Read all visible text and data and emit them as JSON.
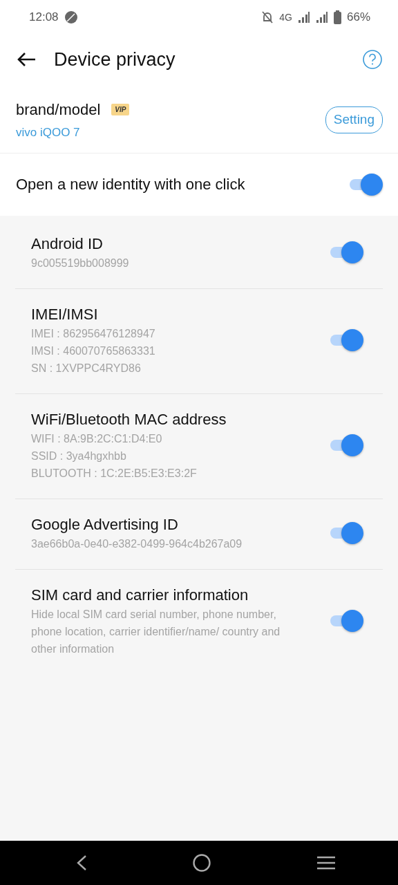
{
  "status_bar": {
    "time": "12:08",
    "network": "4G",
    "battery": "66%"
  },
  "header": {
    "title": "Device privacy"
  },
  "brand": {
    "label": "brand/model",
    "badge": "VIP",
    "value": "vivo iQOO 7",
    "button": "Setting"
  },
  "one_click": {
    "label": "Open a new identity with one click",
    "on": true
  },
  "items": [
    {
      "title": "Android ID",
      "details": [
        "9c005519bb008999"
      ],
      "on": true
    },
    {
      "title": "IMEI/IMSI",
      "details": [
        "IMEI : 862956476128947",
        "IMSI : 460070765863331",
        "SN : 1XVPPC4RYD86"
      ],
      "on": true
    },
    {
      "title": "WiFi/Bluetooth MAC address",
      "details": [
        "WIFI : 8A:9B:2C:C1:D4:E0",
        "SSID : 3ya4hgxhbb",
        "BLUTOOTH : 1C:2E:B5:E3:E3:2F"
      ],
      "on": true
    },
    {
      "title": "Google Advertising ID",
      "details": [
        "3ae66b0a-0e40-e382-0499-964c4b267a09"
      ],
      "on": true
    },
    {
      "title": "SIM card and carrier information",
      "details": [
        "Hide local SIM card serial number, phone number, phone location, carrier identifier/name/ country and other information"
      ],
      "on": true
    }
  ]
}
